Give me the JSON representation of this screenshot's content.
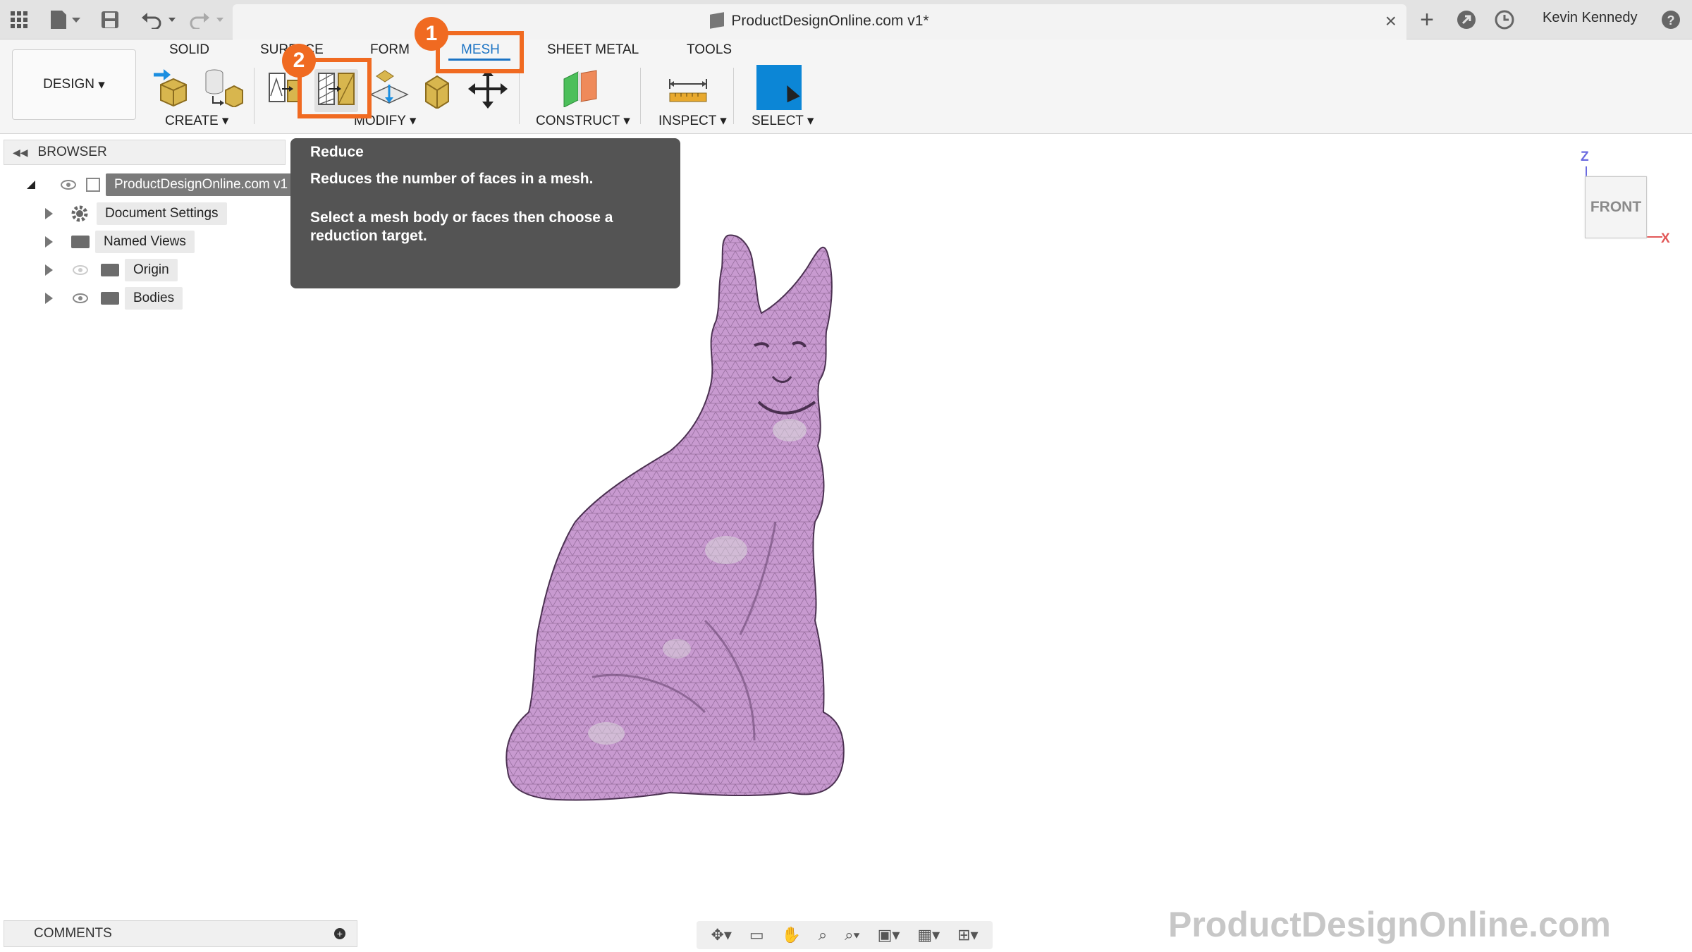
{
  "document": {
    "title": "ProductDesignOnline.com v1*"
  },
  "user": {
    "name": "Kevin Kennedy"
  },
  "workspace": {
    "label": "DESIGN"
  },
  "tabs": [
    {
      "label": "SOLID"
    },
    {
      "label": "SURFACE"
    },
    {
      "label": "FORM"
    },
    {
      "label": "MESH"
    },
    {
      "label": "SHEET METAL"
    },
    {
      "label": "TOOLS"
    }
  ],
  "groups": {
    "create": "CREATE ▾",
    "modify": "MODIFY ▾",
    "construct": "CONSTRUCT ▾",
    "inspect": "INSPECT ▾",
    "select": "SELECT ▾"
  },
  "annotations": {
    "one": "1",
    "two": "2"
  },
  "browser": {
    "header": "BROWSER",
    "root": "ProductDesignOnline.com v1",
    "items": [
      {
        "label": "Document Settings"
      },
      {
        "label": "Named Views"
      },
      {
        "label": "Origin"
      },
      {
        "label": "Bodies"
      }
    ]
  },
  "tooltip": {
    "title": "Reduce",
    "line1": "Reduces the number of faces in a mesh.",
    "line2": "Select a mesh body or faces then choose a reduction target."
  },
  "viewcube": {
    "face": "FRONT",
    "axis_z": "Z",
    "axis_x": "X"
  },
  "comments": {
    "label": "COMMENTS"
  },
  "watermark": "ProductDesignOnline.com",
  "colors": {
    "accent": "#1b73c4",
    "annotation": "#f06a21",
    "mesh": "#c89ad0",
    "select_tile": "#0c86d6"
  }
}
